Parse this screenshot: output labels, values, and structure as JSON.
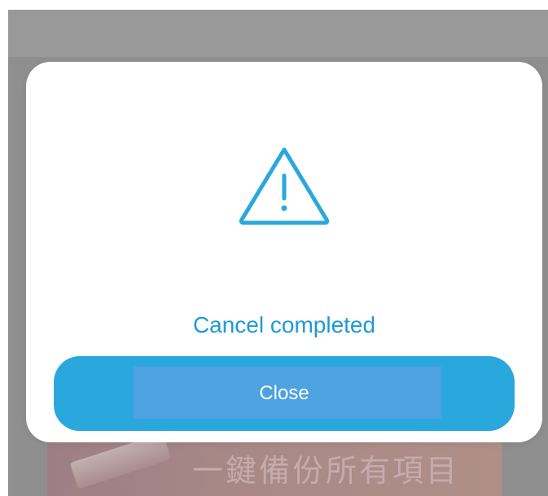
{
  "background": {
    "banner_text": "一鍵備份所有項目"
  },
  "dialog": {
    "icon": "warning-triangle-icon",
    "message": "Cancel completed",
    "close_label": "Close"
  },
  "colors": {
    "accent": "#2aa8de",
    "message_text": "#1e9ad6",
    "overlay": "#8f8f8f"
  }
}
